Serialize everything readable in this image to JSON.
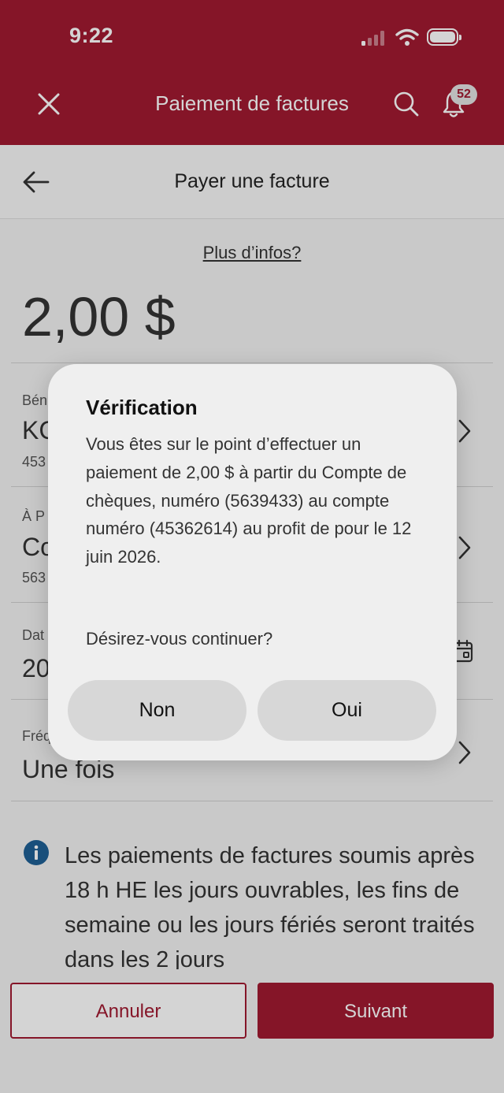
{
  "status_bar": {
    "time": "9:22"
  },
  "header": {
    "title": "Paiement de factures",
    "notification_count": "52"
  },
  "subheader": {
    "title": "Payer une facture"
  },
  "more_info": "Plus d’infos?",
  "amount": "2,00 $",
  "fields": {
    "beneficiary": {
      "label": "Bén",
      "value": "KC",
      "sub": "453"
    },
    "from_account": {
      "label": "À P",
      "value": "Co",
      "sub": "563"
    },
    "date": {
      "label": "Dat",
      "value": "20"
    },
    "frequency": {
      "label": "Fréq",
      "value": "Une fois"
    }
  },
  "info_text": "Les paiements de factures soumis après 18 h HE les jours ouvrables, les fins de semaine ou les jours fériés seront traités dans les 2 jours",
  "actions": {
    "cancel": "Annuler",
    "next": "Suivant"
  },
  "dialog": {
    "title": "Vérification",
    "message": "Vous êtes sur le point d’effectuer un paiement de 2,00 $ à partir du Compte de chèques, numéro (5639433) au compte numéro (45362614) au profit de  pour le 12 juin 2026.",
    "question": "Désirez-vous continuer?",
    "no": "Non",
    "yes": "Oui"
  },
  "colors": {
    "brand": "#a11a31",
    "info": "#1f5f95"
  }
}
